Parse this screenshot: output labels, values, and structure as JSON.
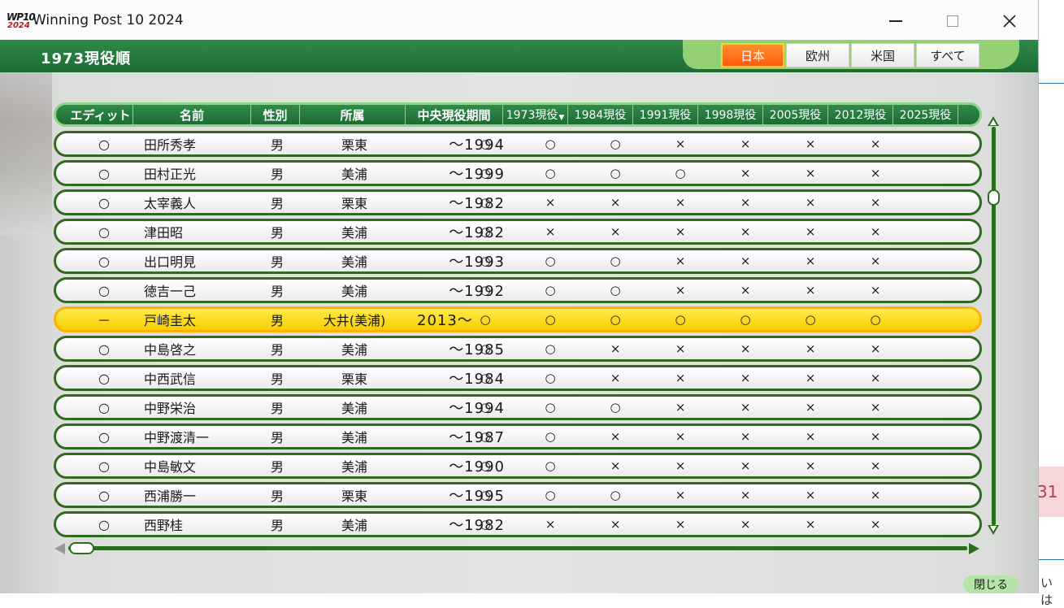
{
  "window": {
    "title": "Winning Post 10 2024",
    "icon_top": "WP10",
    "icon_bottom": "2024"
  },
  "header": {
    "title": "1973現役順"
  },
  "tabs": [
    {
      "label": "日本",
      "active": true
    },
    {
      "label": "欧州",
      "active": false
    },
    {
      "label": "米国",
      "active": false
    },
    {
      "label": "すべて",
      "active": false
    }
  ],
  "table": {
    "columns": [
      "エディット",
      "名前",
      "性別",
      "所属",
      "中央現役期間",
      "1973現役",
      "1984現役",
      "1991現役",
      "1998現役",
      "2005現役",
      "2012現役",
      "2025現役"
    ],
    "rows": [
      {
        "edit": "○",
        "name": "田所秀孝",
        "sex": "男",
        "aff": "栗東",
        "period": "～1994",
        "marks": [
          "○",
          "○",
          "○",
          "×",
          "×",
          "×",
          "×"
        ]
      },
      {
        "edit": "○",
        "name": "田村正光",
        "sex": "男",
        "aff": "美浦",
        "period": "～1999",
        "marks": [
          "○",
          "○",
          "○",
          "○",
          "×",
          "×",
          "×"
        ]
      },
      {
        "edit": "○",
        "name": "太宰義人",
        "sex": "男",
        "aff": "栗東",
        "period": "～1982",
        "marks": [
          "○",
          "×",
          "×",
          "×",
          "×",
          "×",
          "×"
        ]
      },
      {
        "edit": "○",
        "name": "津田昭",
        "sex": "男",
        "aff": "美浦",
        "period": "～1982",
        "marks": [
          "○",
          "×",
          "×",
          "×",
          "×",
          "×",
          "×"
        ]
      },
      {
        "edit": "○",
        "name": "出口明見",
        "sex": "男",
        "aff": "美浦",
        "period": "～1993",
        "marks": [
          "○",
          "○",
          "○",
          "×",
          "×",
          "×",
          "×"
        ]
      },
      {
        "edit": "○",
        "name": "徳吉一己",
        "sex": "男",
        "aff": "美浦",
        "period": "～1992",
        "marks": [
          "○",
          "○",
          "○",
          "×",
          "×",
          "×",
          "×"
        ]
      },
      {
        "edit": "－",
        "name": "戸崎圭太",
        "sex": "男",
        "aff": "大井(美浦)",
        "period": "2013～",
        "marks": [
          "○",
          "○",
          "○",
          "○",
          "○",
          "○",
          "○"
        ],
        "highlight": true
      },
      {
        "edit": "○",
        "name": "中島啓之",
        "sex": "男",
        "aff": "美浦",
        "period": "～1985",
        "marks": [
          "○",
          "○",
          "×",
          "×",
          "×",
          "×",
          "×"
        ]
      },
      {
        "edit": "○",
        "name": "中西武信",
        "sex": "男",
        "aff": "栗東",
        "period": "～1984",
        "marks": [
          "○",
          "○",
          "×",
          "×",
          "×",
          "×",
          "×"
        ]
      },
      {
        "edit": "○",
        "name": "中野栄治",
        "sex": "男",
        "aff": "美浦",
        "period": "～1994",
        "marks": [
          "○",
          "○",
          "○",
          "×",
          "×",
          "×",
          "×"
        ]
      },
      {
        "edit": "○",
        "name": "中野渡清一",
        "sex": "男",
        "aff": "美浦",
        "period": "～1987",
        "marks": [
          "○",
          "○",
          "×",
          "×",
          "×",
          "×",
          "×"
        ]
      },
      {
        "edit": "○",
        "name": "中島敏文",
        "sex": "男",
        "aff": "美浦",
        "period": "～1990",
        "marks": [
          "○",
          "○",
          "×",
          "×",
          "×",
          "×",
          "×"
        ]
      },
      {
        "edit": "○",
        "name": "西浦勝一",
        "sex": "男",
        "aff": "栗東",
        "period": "～1995",
        "marks": [
          "○",
          "○",
          "○",
          "×",
          "×",
          "×",
          "×"
        ]
      },
      {
        "edit": "○",
        "name": "西野桂",
        "sex": "男",
        "aff": "美浦",
        "period": "～1982",
        "marks": [
          "○",
          "×",
          "×",
          "×",
          "×",
          "×",
          "×"
        ]
      }
    ]
  },
  "footer": {
    "close_label": "閉じる"
  },
  "background": {
    "pink_text": "31",
    "bottom_text": "いは"
  },
  "colors": {
    "header_green": "#1d6b34",
    "row_border": "#2f6a1f",
    "highlight": "#ffd800",
    "active_tab": "#ff6a18"
  }
}
